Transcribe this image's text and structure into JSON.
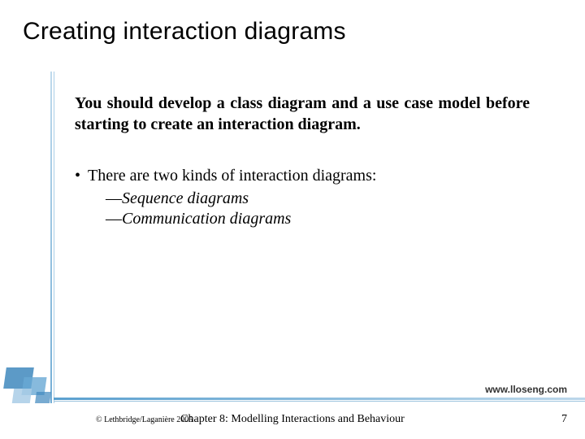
{
  "title": "Creating interaction diagrams",
  "intro": "You should develop a class diagram and a use case model before starting to create an interaction diagram.",
  "bullet": "There are two kinds of interaction diagrams:",
  "kinds": {
    "a": "Sequence diagrams",
    "b": "Communication diagrams"
  },
  "footer": {
    "url": "www.lloseng.com",
    "copyright": "© Lethbridge/Laganière 2005",
    "chapter": "Chapter 8: Modelling Interactions and Behaviour",
    "page": "7"
  }
}
